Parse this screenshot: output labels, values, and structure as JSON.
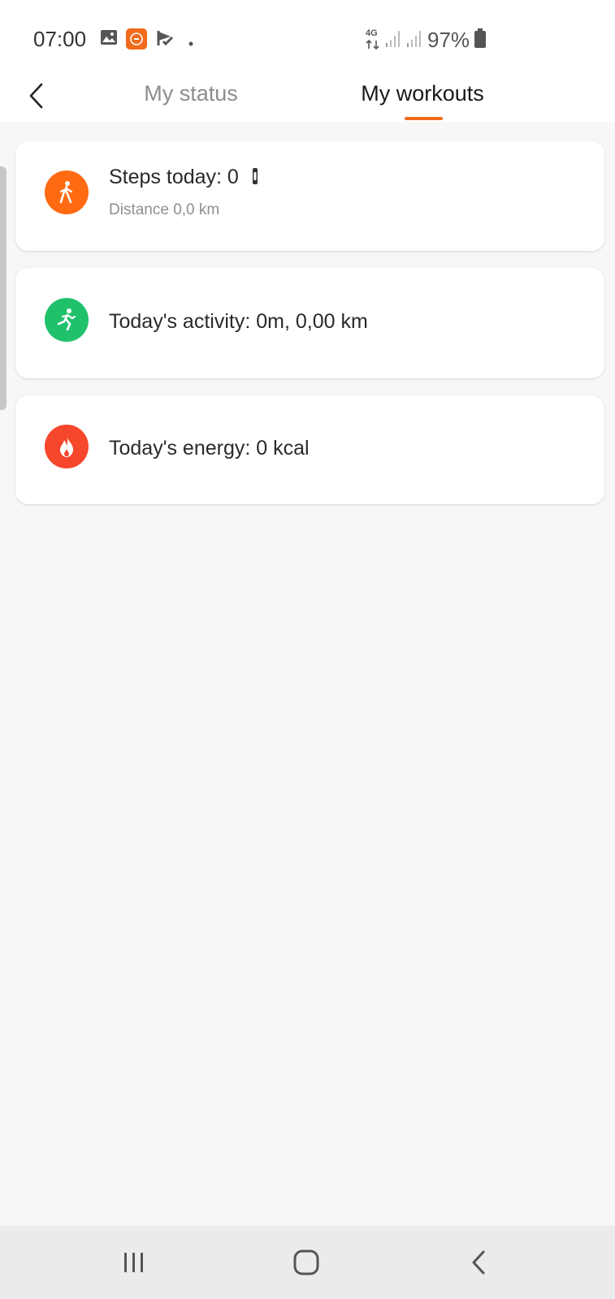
{
  "status_bar": {
    "time": "07:00",
    "notification_icons": [
      "gallery-icon",
      "app-notification-icon",
      "flag-check-icon",
      "dot-icon"
    ],
    "network_label": "4G",
    "battery_percent": "97%"
  },
  "header": {
    "tabs": [
      {
        "label": "My status",
        "active": false
      },
      {
        "label": "My workouts",
        "active": true
      }
    ],
    "accent_color": "#f26a1b"
  },
  "cards": [
    {
      "icon": "walking-icon",
      "icon_color": "#ff6a13",
      "title": "Steps today: 0",
      "subtitle": "Distance 0,0 km"
    },
    {
      "icon": "running-icon",
      "icon_color": "#1fc16b",
      "title": "Today's activity: 0m, 0,00 km"
    },
    {
      "icon": "flame-icon",
      "icon_color": "#f6472c",
      "title": "Today's energy: 0 kcal"
    }
  ],
  "nav_bar": {
    "buttons": [
      "recent-apps",
      "home",
      "back"
    ]
  }
}
